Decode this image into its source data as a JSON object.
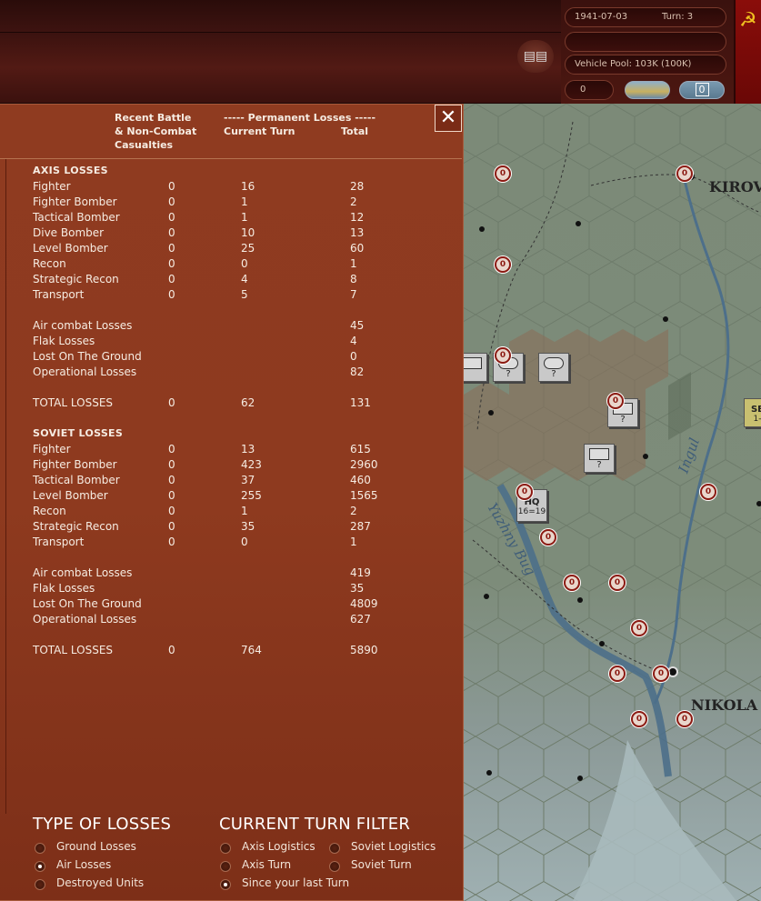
{
  "hud": {
    "date": "1941-07-03",
    "turn": "Turn: 3",
    "vehicle_pool": "Vehicle Pool: 103K (100K)",
    "counter": "0",
    "toggle_value": "0"
  },
  "panel": {
    "header": {
      "col1": "Recent Battle\n& Non-Combat\nCasualties",
      "col2": "----- Permanent Losses -----",
      "col2a": "Current Turn",
      "col2b": "Total"
    },
    "axis": {
      "title": "AXIS LOSSES",
      "rows": [
        {
          "label": "Fighter",
          "recent": "0",
          "current": "16",
          "total": "28"
        },
        {
          "label": "Fighter Bomber",
          "recent": "0",
          "current": "1",
          "total": "2"
        },
        {
          "label": "Tactical Bomber",
          "recent": "0",
          "current": "1",
          "total": "12"
        },
        {
          "label": "Dive Bomber",
          "recent": "0",
          "current": "10",
          "total": "13"
        },
        {
          "label": "Level Bomber",
          "recent": "0",
          "current": "25",
          "total": "60"
        },
        {
          "label": "Recon",
          "recent": "0",
          "current": "0",
          "total": "1"
        },
        {
          "label": "Strategic Recon",
          "recent": "0",
          "current": "4",
          "total": "8"
        },
        {
          "label": "Transport",
          "recent": "0",
          "current": "5",
          "total": "7"
        }
      ],
      "summary": [
        {
          "label": "Air combat Losses",
          "total": "45"
        },
        {
          "label": "Flak Losses",
          "total": "4"
        },
        {
          "label": "Lost On The Ground",
          "total": "0"
        },
        {
          "label": "Operational Losses",
          "total": "82"
        }
      ],
      "totals": {
        "label": "TOTAL LOSSES",
        "recent": "0",
        "current": "62",
        "total": "131"
      }
    },
    "soviet": {
      "title": "SOVIET LOSSES",
      "rows": [
        {
          "label": "Fighter",
          "recent": "0",
          "current": "13",
          "total": "615"
        },
        {
          "label": "Fighter Bomber",
          "recent": "0",
          "current": "423",
          "total": "2960"
        },
        {
          "label": "Tactical Bomber",
          "recent": "0",
          "current": "37",
          "total": "460"
        },
        {
          "label": "Level Bomber",
          "recent": "0",
          "current": "255",
          "total": "1565"
        },
        {
          "label": "Recon",
          "recent": "0",
          "current": "1",
          "total": "2"
        },
        {
          "label": "Strategic Recon",
          "recent": "0",
          "current": "35",
          "total": "287"
        },
        {
          "label": "Transport",
          "recent": "0",
          "current": "0",
          "total": "1"
        }
      ],
      "summary": [
        {
          "label": "Air combat Losses",
          "total": "419"
        },
        {
          "label": "Flak Losses",
          "total": "35"
        },
        {
          "label": "Lost On The Ground",
          "total": "4809"
        },
        {
          "label": "Operational Losses",
          "total": "627"
        }
      ],
      "totals": {
        "label": "TOTAL LOSSES",
        "recent": "0",
        "current": "764",
        "total": "5890"
      }
    },
    "type_of_losses": {
      "title": "TYPE OF LOSSES",
      "options": [
        {
          "label": "Ground Losses",
          "selected": false
        },
        {
          "label": "Air Losses",
          "selected": true
        },
        {
          "label": "Destroyed Units",
          "selected": false
        }
      ]
    },
    "turn_filter": {
      "title": "CURRENT TURN FILTER",
      "options": [
        {
          "label": "Axis Logistics",
          "selected": false
        },
        {
          "label": "Soviet Logistics",
          "selected": false
        },
        {
          "label": "Axis Turn",
          "selected": false
        },
        {
          "label": "Soviet Turn",
          "selected": false
        },
        {
          "label": "Since your last Turn",
          "selected": true
        }
      ]
    }
  },
  "map": {
    "cities": [
      "KIROV",
      "NIKOLA"
    ],
    "rivers": [
      "Ingul",
      "Yuzhny Bug"
    ],
    "hq_label": "HQ",
    "hq_strength": "16=19",
    "unit_question": "?",
    "marker_text": "0",
    "edge_unit": "SE",
    "edge_unit_sub": "1-"
  }
}
